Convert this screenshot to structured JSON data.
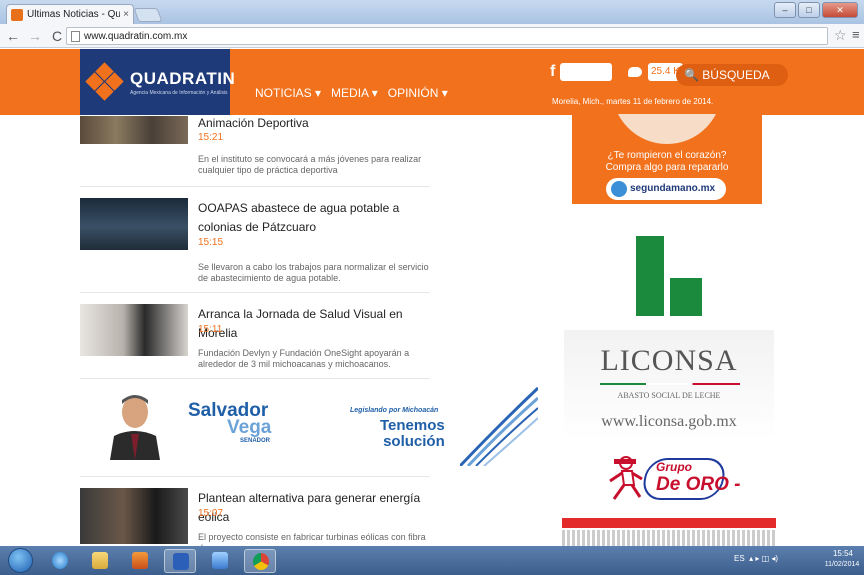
{
  "browser": {
    "tab_title": "Últimas Noticias - Quadr",
    "tab_close": "×",
    "url": "www.quadratin.com.mx",
    "back_icon": "←",
    "forward_icon": "→",
    "reload_icon": "C",
    "star_icon": "☆",
    "menu_icon": "≡",
    "min_icon": "–",
    "max_icon": "□",
    "close_icon": "✕"
  },
  "header": {
    "logo_name": "QUADRATIN",
    "logo_tagline": "Agencia Mexicana de Información y Análisis",
    "nav": [
      {
        "label": "NOTICIAS ▾"
      },
      {
        "label": "MEDIA ▾"
      },
      {
        "label": "OPINIÓN ▾"
      }
    ],
    "facebook_icon": "f",
    "twitter_count": "25.4 K",
    "search_label": "🔍 BÚSQUEDA",
    "date": "Morelia, Mich., martes 11 de febrero de 2014."
  },
  "news": [
    {
      "title": "Animación Deportiva",
      "time": "15:21",
      "summary": "En el instituto se convocará a más jóvenes para realizar cualquier tipo de práctica deportiva"
    },
    {
      "title": "OOAPAS abastece de agua potable a colonias de Pátzcuaro",
      "time": "15:15",
      "summary": "Se llevaron a cabo los trabajos para normalizar el servicio de abastecimiento de agua potable."
    },
    {
      "title": "Arranca la Jornada de Salud Visual en Morelia",
      "time": "15:11",
      "summary": "Fundación Devlyn y Fundación OneSight apoyarán a alrededor de 3 mil michoacanas y michoacanos."
    },
    {
      "title": "Plantean alternativa para generar energía eólica",
      "time": "15:07",
      "summary": "El proyecto consiste en fabricar turbinas eólicas con fibra de"
    }
  ],
  "ad_banner": {
    "name1": "Salvador",
    "name2": "Vega",
    "role": "SENADOR",
    "motto": "Legislando por Michoacán",
    "slogan1": "Tenemos",
    "slogan2": "solución"
  },
  "ad_segundamano": {
    "line1": "¿Te rompieron el corazón?",
    "line2": "Compra algo para repararlo",
    "brand": "segundamano.mx"
  },
  "ad_liconsa": {
    "name": "LICONSA",
    "subtitle": "ABASTO SOCIAL DE LECHE",
    "url": "www.liconsa.gob.mx"
  },
  "ad_oro": {
    "line1": "Grupo",
    "line2": "De ORO -"
  },
  "taskbar": {
    "lang": "ES",
    "tray_icons": "▴ ▸ ◫ ◂)",
    "time": "15:54",
    "date": "11/02/2014"
  },
  "colors": {
    "brand_orange": "#f2711c",
    "logo_navy": "#1e3a78",
    "liconsa_green": "#1c8a3c"
  }
}
